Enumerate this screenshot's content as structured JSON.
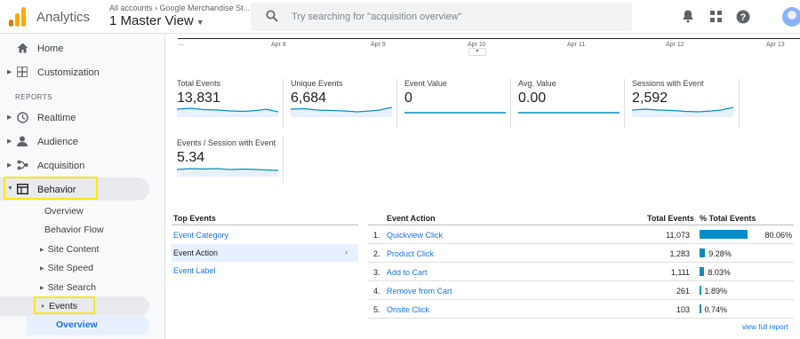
{
  "brand": {
    "app_name": "Analytics",
    "colors": {
      "accent": "#1a73e8",
      "bar": "#058dc7",
      "highlight": "#f8e71c",
      "logo_orange": "#f9ab00",
      "logo_dark": "#e37400"
    }
  },
  "header": {
    "account_path": "All accounts › Google Merchandise St...",
    "view_name": "1 Master View",
    "search_placeholder": "Try searching for \"acquisition overview\"",
    "icons": [
      "search-icon",
      "bell-icon",
      "apps-grid-icon",
      "help-icon",
      "account-avatar"
    ]
  },
  "sidebar": {
    "top_items": [
      {
        "label": "Home",
        "icon": "home-icon"
      },
      {
        "label": "Customization",
        "icon": "grid-icon"
      }
    ],
    "section_label": "REPORTS",
    "report_items": [
      {
        "label": "Realtime",
        "icon": "clock-icon"
      },
      {
        "label": "Audience",
        "icon": "person-icon"
      },
      {
        "label": "Acquisition",
        "icon": "acquisition-icon"
      },
      {
        "label": "Behavior",
        "icon": "behavior-icon"
      }
    ],
    "behavior_children": [
      "Overview",
      "Behavior Flow",
      "Site Content",
      "Site Speed",
      "Site Search",
      "Events"
    ],
    "events_children": [
      "Overview"
    ]
  },
  "timeline": {
    "start": "...",
    "ticks": [
      "Apr 8",
      "Apr 9",
      "Apr 10",
      "Apr 11",
      "Apr 12",
      "Apr 13"
    ]
  },
  "metrics": [
    {
      "label": "Total Events",
      "value": "13,831"
    },
    {
      "label": "Unique Events",
      "value": "6,684"
    },
    {
      "label": "Event Value",
      "value": "0"
    },
    {
      "label": "Avg. Value",
      "value": "0.00"
    },
    {
      "label": "Sessions with Event",
      "value": "2,592"
    },
    {
      "label": "Events / Session with Event",
      "value": "5.34"
    }
  ],
  "top_events": {
    "header": "Top Events",
    "rows": [
      "Event Category",
      "Event Action",
      "Event Label"
    ],
    "selected": "Event Action"
  },
  "events_table": {
    "headers": {
      "action": "Event Action",
      "total": "Total Events",
      "pct": "% Total Events"
    },
    "rows": [
      {
        "idx": "1.",
        "name": "Quickview Click",
        "total": "11,073",
        "pct": "80.06%",
        "share": 80.06
      },
      {
        "idx": "2.",
        "name": "Product Click",
        "total": "1,283",
        "pct": "9.28%",
        "share": 9.28
      },
      {
        "idx": "3.",
        "name": "Add to Cart",
        "total": "1,111",
        "pct": "8.03%",
        "share": 8.03
      },
      {
        "idx": "4.",
        "name": "Remove from Cart",
        "total": "261",
        "pct": "1.89%",
        "share": 1.89
      },
      {
        "idx": "5.",
        "name": "Onsite Click",
        "total": "103",
        "pct": "0.74%",
        "share": 0.74
      }
    ],
    "view_full_report": "view full report"
  }
}
